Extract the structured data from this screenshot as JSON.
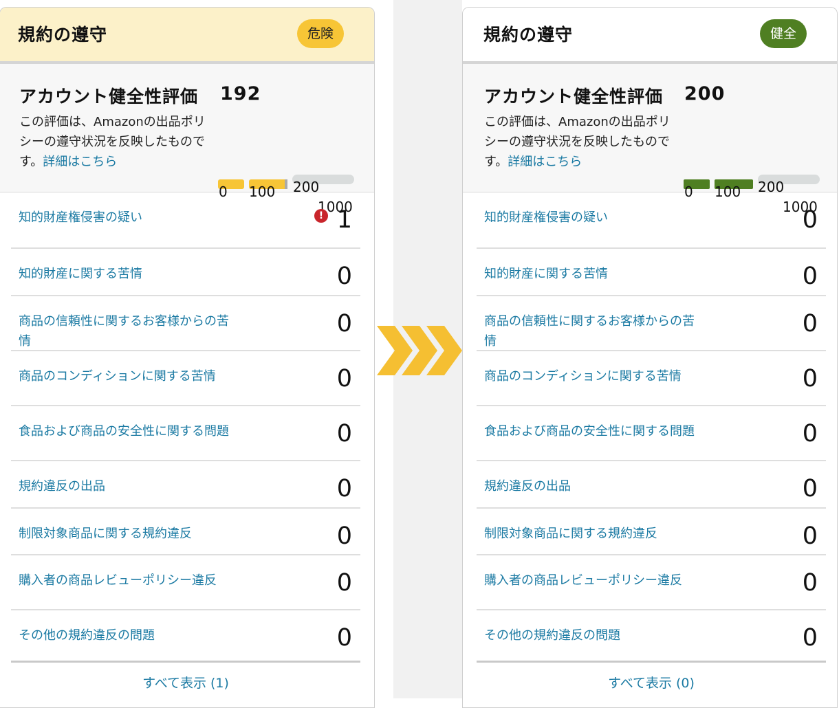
{
  "colors": {
    "warning_yellow": "#f7c536",
    "healthy_green": "#4f7f22",
    "link_blue": "#1b7aa3",
    "arrow_yellow": "#f5bf32"
  },
  "panels": [
    {
      "title": "規約の遵守",
      "status_badge": "危険",
      "rating_title": "アカウント健全性評価",
      "rating_score": "192",
      "rating_desc": "この評価は、Amazonの出品ポリシーの遵守状況を反映したものです。",
      "rating_link": "詳細はこちら",
      "ticks": [
        "0",
        "100",
        "200",
        "1000"
      ],
      "rating_level": 192,
      "rows": [
        {
          "label": "知的財産権侵害の疑い",
          "count": "1",
          "alert": "!"
        },
        {
          "label": "知的財産に関する苦情",
          "count": "0"
        },
        {
          "label": "商品の信頼性に関するお客様からの苦情",
          "count": "0"
        },
        {
          "label": "商品のコンディションに関する苦情",
          "count": "0"
        },
        {
          "label": "食品および商品の安全性に関する問題",
          "count": "0"
        },
        {
          "label": "規約違反の出品",
          "count": "0"
        },
        {
          "label": "制限対象商品に関する規約違反",
          "count": "0"
        },
        {
          "label": "購入者の商品レビューポリシー違反",
          "count": "0"
        },
        {
          "label": "その他の規約違反の問題",
          "count": "0"
        }
      ],
      "show_all": "すべて表示 (1)"
    },
    {
      "title": "規約の遵守",
      "status_badge": "健全",
      "rating_title": "アカウント健全性評価",
      "rating_score": "200",
      "rating_desc": "この評価は、Amazonの出品ポリシーの遵守状況を反映したものです。",
      "rating_link": "詳細はこちら",
      "ticks": [
        "0",
        "100",
        "200",
        "1000"
      ],
      "rating_level": 200,
      "rows": [
        {
          "label": "知的財産権侵害の疑い",
          "count": "0"
        },
        {
          "label": "知的財産に関する苦情",
          "count": "0"
        },
        {
          "label": "商品の信頼性に関するお客様からの苦情",
          "count": "0"
        },
        {
          "label": "商品のコンディションに関する苦情",
          "count": "0"
        },
        {
          "label": "食品および商品の安全性に関する問題",
          "count": "0"
        },
        {
          "label": "規約違反の出品",
          "count": "0"
        },
        {
          "label": "制限対象商品に関する規約違反",
          "count": "0"
        },
        {
          "label": "購入者の商品レビューポリシー違反",
          "count": "0"
        },
        {
          "label": "その他の規約違反の問題",
          "count": "0"
        }
      ],
      "show_all": "すべて表示 (0)"
    }
  ],
  "arrow_icon": "triple-chevron-right-icon"
}
